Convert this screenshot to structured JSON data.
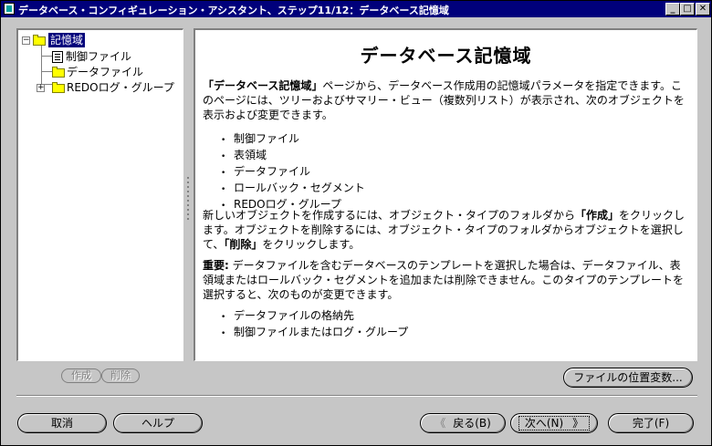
{
  "window": {
    "title": "データベース・コンフィギュレーション・アシスタント、ステップ11/12：データベース記憶域",
    "controls": {
      "minimize": "_",
      "maximize": "□",
      "close": "✕"
    }
  },
  "tree": {
    "root": {
      "label": "記憶域",
      "expander": "−"
    },
    "items": [
      {
        "label": "制御ファイル"
      },
      {
        "label": "データファイル"
      },
      {
        "label": "REDOログ・グループ",
        "expander": "+"
      }
    ]
  },
  "help": {
    "title": "データベース記憶域",
    "para1_bold": "「データベース記憶域」",
    "para1_rest": "ページから、データベース作成用の記憶域パラメータを指定できます。このページには、ツリーおよびサマリー・ビュー（複数列リスト）が表示され、次のオブジェクトを表示および変更できます。",
    "bullets1": [
      "制御ファイル",
      "表領域",
      "データファイル",
      "ロールバック・セグメント",
      "REDOログ・グループ"
    ],
    "para2_a": "新しいオブジェクトを作成するには、オブジェクト・タイプのフォルダから",
    "para2_b": "「作成」",
    "para2_c": "をクリックします。オブジェクトを削除するには、オブジェクト・タイプのフォルダからオブジェクトを選択して、",
    "para2_d": "「削除」",
    "para2_e": "をクリックします。",
    "para3_bold": "重要:",
    "para3_rest": " データファイルを含むデータベースのテンプレートを選択した場合は、データファイル、表領域またはロールバック・セグメントを追加または削除できません。このタイプのテンプレートを選択すると、次のものが変更できます。",
    "bullets2": [
      "データファイルの格納先",
      "制御ファイルまたはログ・グループ"
    ]
  },
  "buttons": {
    "create": "作成",
    "delete": "削除",
    "file_location": "ファイルの位置変数...",
    "cancel": "取消",
    "help": "ヘルプ",
    "back": "戻る(B)",
    "back_arrow": "《",
    "next": "次へ(N)",
    "next_arrow": "》",
    "finish": "完了(F)"
  }
}
